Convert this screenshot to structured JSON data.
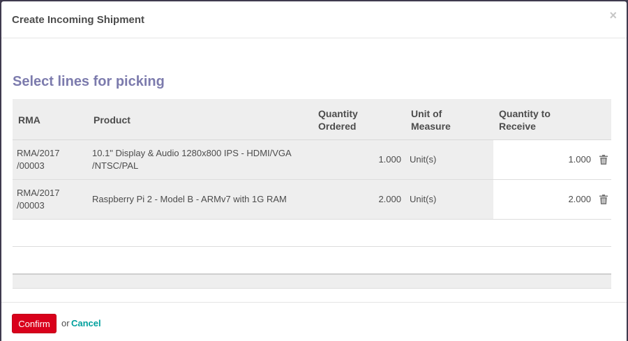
{
  "dialog": {
    "title": "Create Incoming Shipment",
    "close_label": "×"
  },
  "section": {
    "title": "Select lines for picking"
  },
  "table": {
    "headers": {
      "rma": "RMA",
      "product": "Product",
      "qty_ordered_1": "Quantity",
      "qty_ordered_2": "Ordered",
      "uom_1": "Unit of",
      "uom_2": "Measure",
      "qty_receive_1": "Quantity to",
      "qty_receive_2": "Receive"
    },
    "rows": [
      {
        "rma_1": "RMA/2017",
        "rma_2": "/00003",
        "product_1": "10.1\" Display & Audio 1280x800 IPS - HDMI/VGA",
        "product_2": "/NTSC/PAL",
        "qty_ordered": "1.000",
        "uom": "Unit(s)",
        "qty_receive": "1.000"
      },
      {
        "rma_1": "RMA/2017",
        "rma_2": "/00003",
        "product_1": "Raspberry Pi 2 - Model B - ARMv7 with 1G RAM",
        "product_2": "",
        "qty_ordered": "2.000",
        "uom": "Unit(s)",
        "qty_receive": "2.000"
      }
    ]
  },
  "footer": {
    "confirm_label": "Confirm",
    "or_label": "or",
    "cancel_label": "Cancel"
  },
  "colors": {
    "accent": "#7c7bad",
    "primary_button": "#d9001b",
    "link": "#00a09d"
  }
}
